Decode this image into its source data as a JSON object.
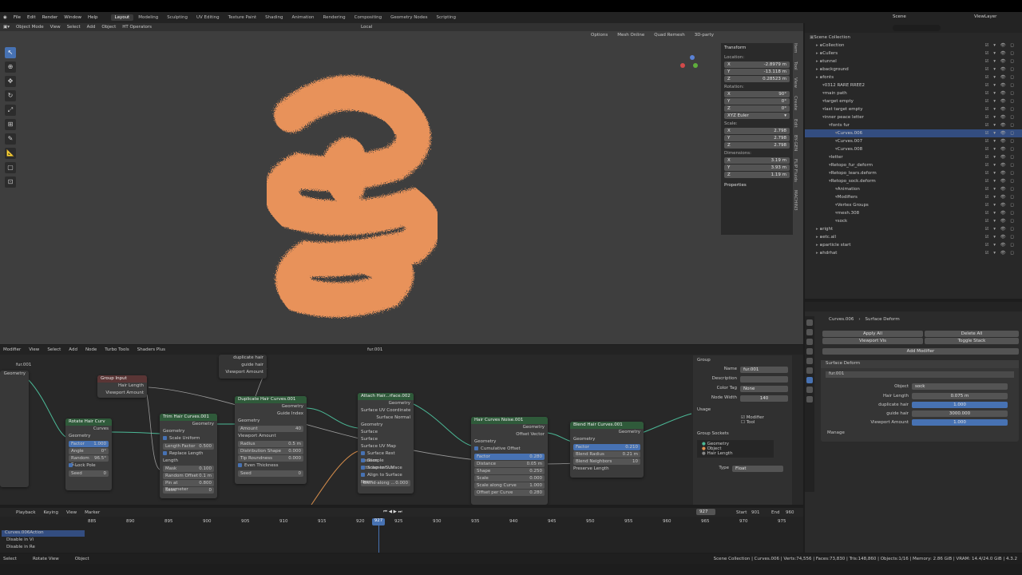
{
  "menu": {
    "file": "File",
    "edit": "Edit",
    "render": "Render",
    "window": "Window",
    "help": "Help"
  },
  "workspaces": [
    "Layout",
    "Modeling",
    "Sculpting",
    "UV Editing",
    "Texture Paint",
    "Shading",
    "Animation",
    "Rendering",
    "Compositing",
    "Geometry Nodes",
    "Scripting"
  ],
  "scene": {
    "label": "Scene",
    "view_layer": "ViewLayer"
  },
  "viewport": {
    "mode": "Object Mode",
    "menus": [
      "View",
      "Select",
      "Add",
      "Object",
      "HT Operators"
    ],
    "orientation": "Local",
    "options": "Options",
    "mesh_online": "Mesh Online",
    "quad_remesh": "Quad Remesh",
    "party": "3D-party"
  },
  "npanel": {
    "transform": "Transform",
    "location": "Location:",
    "loc": [
      {
        "a": "X",
        "v": "-2.8979 m"
      },
      {
        "a": "Y",
        "v": "-13.118 m"
      },
      {
        "a": "Z",
        "v": "0.28523 m"
      }
    ],
    "rotation": "Rotation:",
    "rot": [
      {
        "a": "X",
        "v": "90°"
      },
      {
        "a": "Y",
        "v": "0°"
      },
      {
        "a": "Z",
        "v": "0°"
      }
    ],
    "euler": "XYZ Euler",
    "scale": "Scale:",
    "scl": [
      {
        "a": "X",
        "v": "2.798"
      },
      {
        "a": "Y",
        "v": "2.798"
      },
      {
        "a": "Z",
        "v": "2.798"
      }
    ],
    "dimensions": "Dimensions:",
    "dim": [
      {
        "a": "X",
        "v": "3.19 m"
      },
      {
        "a": "Y",
        "v": "3.93 m"
      },
      {
        "a": "Z",
        "v": "1.19 m"
      }
    ],
    "properties": "Properties"
  },
  "vtabs": [
    "Item",
    "Tool",
    "View",
    "Create",
    "Edit",
    "BY-GEN",
    "FLIP Fluids",
    "MACHIN3"
  ],
  "outliner": {
    "search": "",
    "rows": [
      {
        "n": "Scene Collection",
        "d": 0
      },
      {
        "n": "Collection",
        "d": 1
      },
      {
        "n": "Cullers",
        "d": 1
      },
      {
        "n": "tunnel",
        "d": 1
      },
      {
        "n": "background",
        "d": 1
      },
      {
        "n": "fonts",
        "d": 1
      },
      {
        "n": "0312 RARE RREE2",
        "d": 2
      },
      {
        "n": "main path",
        "d": 2
      },
      {
        "n": "target empty",
        "d": 2
      },
      {
        "n": "last target empty",
        "d": 2
      },
      {
        "n": "inner peace letter",
        "d": 2
      },
      {
        "n": "fonts fur",
        "d": 3
      },
      {
        "n": "Curves.006",
        "d": 4,
        "sel": true
      },
      {
        "n": "Curves.007",
        "d": 4
      },
      {
        "n": "Curves.008",
        "d": 4
      },
      {
        "n": "letter",
        "d": 3
      },
      {
        "n": "Retopo_fur_deform",
        "d": 3
      },
      {
        "n": "Retopo_lears.deform",
        "d": 3
      },
      {
        "n": "Retopo_sock.deform",
        "d": 3
      },
      {
        "n": "Animation",
        "d": 4
      },
      {
        "n": "Modifiers",
        "d": 4
      },
      {
        "n": "Vertex Groups",
        "d": 4
      },
      {
        "n": "mesh.308",
        "d": 4
      },
      {
        "n": "sock",
        "d": 4
      },
      {
        "n": "right",
        "d": 1
      },
      {
        "n": "etc.all",
        "d": 1
      },
      {
        "n": "particle start",
        "d": 1
      },
      {
        "n": "hdrhat",
        "d": 1
      }
    ]
  },
  "props": {
    "object": "Curves.006",
    "modifier": "Surface Deform",
    "apply_all": "Apply All",
    "delete_all": "Delete All",
    "viewport_vis": "Viewport Vis",
    "toggle_stack": "Toggle Stack",
    "add_modifier": "Add Modifier",
    "surface_deform": "Surface Deform",
    "group": "fur.001",
    "obj_label": "Object",
    "obj_val": "sock",
    "hair_length_l": "Hair Length",
    "hair_length": "0.075 m",
    "dup_hair_l": "duplicate hair",
    "dup_hair": "1.000",
    "guide_l": "guide hair",
    "guide": "3000.000",
    "vp_amount_l": "Viewport Amount",
    "vp_amount": "1.000",
    "manage": "Manage"
  },
  "ne": {
    "editor": "Modifier",
    "menus": [
      "View",
      "Select",
      "Add",
      "Node",
      "Turbo Tools",
      "Shaders Plus"
    ],
    "tree": "fur.001",
    "nodes": {
      "hairlen": {
        "r": [
          "Hair Length",
          "Viewport Amount"
        ]
      },
      "grp": {
        "t": "Group Input"
      },
      "dup": {
        "r": [
          "duplicate hair",
          "guide hair",
          "Viewport Amount"
        ]
      },
      "rot": {
        "t": "Rotate Hair Curv",
        "o": "Curves",
        "r": [
          "Geometry",
          "Curves"
        ],
        "f": [
          "Factor|1.000",
          "Angle|0°",
          "Random S...|96.5°",
          "Seed|0"
        ],
        "lock": "Lock Pole"
      },
      "trim": {
        "t": "Trim Hair Curves.001",
        "o": "Geometry",
        "r": [
          "Geometry"
        ],
        "cbx": [
          "Scale Uniform",
          "Replace Length"
        ],
        "f": [
          "Length Factor|0.500",
          "Random Offset|0.1 m",
          "Pin at Parameter|0.800",
          "Seed|0"
        ],
        "l": "Length",
        "m": "Mask"
      },
      "dupn": {
        "t": "Duplicate Hair Curves.001",
        "o1": "Geometry",
        "o2": "Guide Index",
        "r": [
          "Geometry",
          "Amount",
          "Viewport Amount"
        ],
        "f": [
          "Amount|40",
          "Radius|0.5 m",
          "Distribution Shape|0.000",
          "Tip Roundness|0.000",
          "Seed|0"
        ],
        "cbx": "Even Thickness"
      },
      "attach": {
        "t": "Attach Hair...rface.002",
        "o": "Geometry",
        "r": [
          "Surface UV Coordinate",
          "Surface Normal"
        ],
        "in": [
          "Geometry",
          "Surface",
          "Surface",
          "Surface UV Map"
        ],
        "cbx": [
          "Surface Rest Position",
          "Sample Attachment UV",
          "Snap to Surface",
          "Align to Surface Norm..."
        ],
        "f": "Blend along ...|0.000"
      },
      "noise": {
        "t": "Hair Curves Noise.001",
        "o1": "Geometry",
        "o2": "Offset Vector",
        "r": [
          "Geometry"
        ],
        "cbx": "Cumulative Offset",
        "f": [
          "Factor|0.280",
          "Distance|0.05 m",
          "Shape|0.250",
          "Scale|0.000",
          "Scale along Curve|1.000",
          "Offset per Curve|0.280"
        ]
      },
      "blend": {
        "t": "Blend Hair Curves.001",
        "o": "Geometry",
        "r": [
          "Geometry"
        ],
        "f": [
          "Factor|0.210",
          "Blend Radius|0.21 m",
          "Blend Neighbors|10"
        ],
        "p": "Preserve Length"
      }
    },
    "gpanel": {
      "title": "Group",
      "name_l": "Name",
      "name": "fur.001",
      "desc": "Description",
      "tag_l": "Color Tag",
      "tag": "None",
      "width_l": "Node Width",
      "width": "140",
      "usage": "Usage",
      "modifier": "Modifier",
      "tool": "Tool",
      "sockets": "Group Sockets",
      "s1": "Geometry",
      "s2": "Object",
      "s3": "Hair Length",
      "type_l": "Type",
      "type": "Float"
    }
  },
  "timeline": {
    "playback": "Playback",
    "keying": "Keying",
    "view": "View",
    "marker": "Marker",
    "frame": "927",
    "start_l": "Start",
    "start": "901",
    "end_l": "End",
    "end": "960",
    "ticks": [
      "885",
      "890",
      "895",
      "900",
      "905",
      "910",
      "915",
      "920",
      "925",
      "930",
      "935",
      "940",
      "945",
      "950",
      "955",
      "960",
      "965",
      "970",
      "975"
    ],
    "action": "Curves.006Action",
    "dis1": "Disable in Vi",
    "dis2": "Disable in Re"
  },
  "status": {
    "select": "Select",
    "rotate": "Rotate View",
    "object": "Object",
    "info": "Scene Collection | Curves.006 | Verts:74,556 | Faces:73,830 | Tris:148,860 | Objects:1/16 | Memory: 2.86 GiB | VRAM: 14.4/24.0 GiB | 4.3.2"
  }
}
